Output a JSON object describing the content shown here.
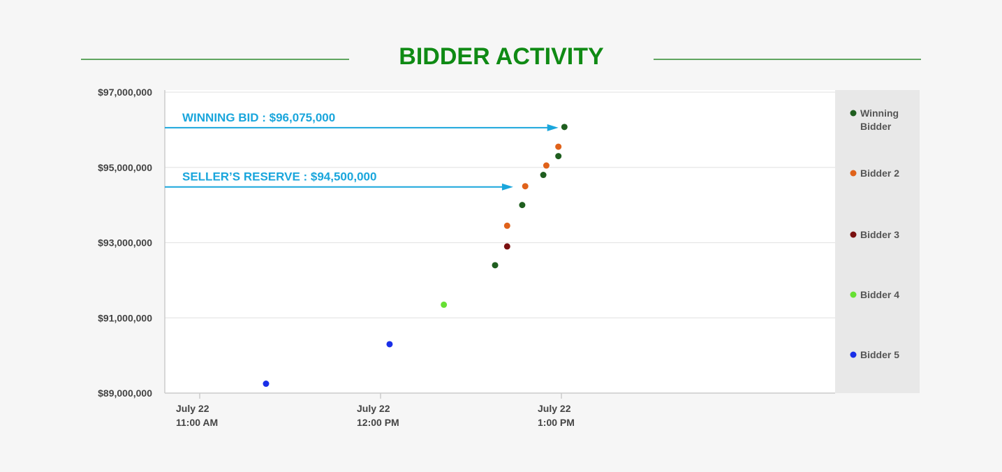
{
  "title": "BIDDER ACTIVITY",
  "colors": {
    "title": "#0f8a14",
    "title_rule": "#2e8b2e",
    "annotation": "#1aa6dc",
    "grid": "#e6e6e6",
    "axis": "#cccccc",
    "legend_bg": "#e8e8e8",
    "plot_bg": "#ffffff",
    "page_bg": "#f6f6f6"
  },
  "chart_data": {
    "type": "scatter",
    "title": "BIDDER ACTIVITY",
    "xlabel": "",
    "ylabel": "",
    "xlim": [
      "July 22 10:45 AM",
      "July 22 2:45 PM"
    ],
    "ylim": [
      89000000,
      97000000
    ],
    "y_ticks": [
      {
        "value": 89000000,
        "label": "$89,000,000"
      },
      {
        "value": 91000000,
        "label": "$91,000,000"
      },
      {
        "value": 93000000,
        "label": "$93,000,000"
      },
      {
        "value": 95000000,
        "label": "$95,000,000"
      },
      {
        "value": 97000000,
        "label": "$97,000,000"
      }
    ],
    "x_ticks": [
      {
        "time": "July 22 11:00 AM",
        "line1": "July 22",
        "line2": "11:00 AM"
      },
      {
        "time": "July 22 12:00 PM",
        "line1": "July 22",
        "line2": "12:00 PM"
      },
      {
        "time": "July 22 1:00 PM",
        "line1": "July 22",
        "line2": "1:00 PM"
      }
    ],
    "grid": true,
    "legend_position": "right",
    "series": [
      {
        "name": "Winning Bidder",
        "legend_lines": [
          "Winning",
          "Bidder"
        ],
        "color": "#1f5e1f",
        "points": [
          {
            "time": "July 22 12:38 PM",
            "value": 92400000
          },
          {
            "time": "July 22 12:47 PM",
            "value": 94000000
          },
          {
            "time": "July 22 12:54 PM",
            "value": 94800000
          },
          {
            "time": "July 22 12:59 PM",
            "value": 95300000
          },
          {
            "time": "July 22 1:01 PM",
            "value": 96075000
          }
        ]
      },
      {
        "name": "Bidder 2",
        "legend_lines": [
          "Bidder 2"
        ],
        "color": "#e0621a",
        "points": [
          {
            "time": "July 22 12:42 PM",
            "value": 93450000
          },
          {
            "time": "July 22 12:48 PM",
            "value": 94500000
          },
          {
            "time": "July 22 12:55 PM",
            "value": 95050000
          },
          {
            "time": "July 22 12:59 PM",
            "value": 95550000
          }
        ]
      },
      {
        "name": "Bidder 3",
        "legend_lines": [
          "Bidder 3"
        ],
        "color": "#7a1010",
        "points": [
          {
            "time": "July 22 12:42 PM",
            "value": 92900000
          }
        ]
      },
      {
        "name": "Bidder 4",
        "legend_lines": [
          "Bidder 4"
        ],
        "color": "#66e033",
        "points": [
          {
            "time": "July 22 12:21 PM",
            "value": 91350000
          }
        ]
      },
      {
        "name": "Bidder 5",
        "legend_lines": [
          "Bidder 5"
        ],
        "color": "#1a2fe8",
        "points": [
          {
            "time": "July 22 11:22 AM",
            "value": 89250000
          },
          {
            "time": "July 22 12:03 PM",
            "value": 90300000
          }
        ]
      }
    ],
    "annotations": [
      {
        "text": "WINNING BID : $96,075,000",
        "value": 96075000,
        "arrow_to_time": "July 22 12:59 PM"
      },
      {
        "text": "SELLER’S RESERVE : $94,500,000",
        "value": 94500000,
        "arrow_to_time": "July 22 12:44 PM"
      }
    ]
  }
}
